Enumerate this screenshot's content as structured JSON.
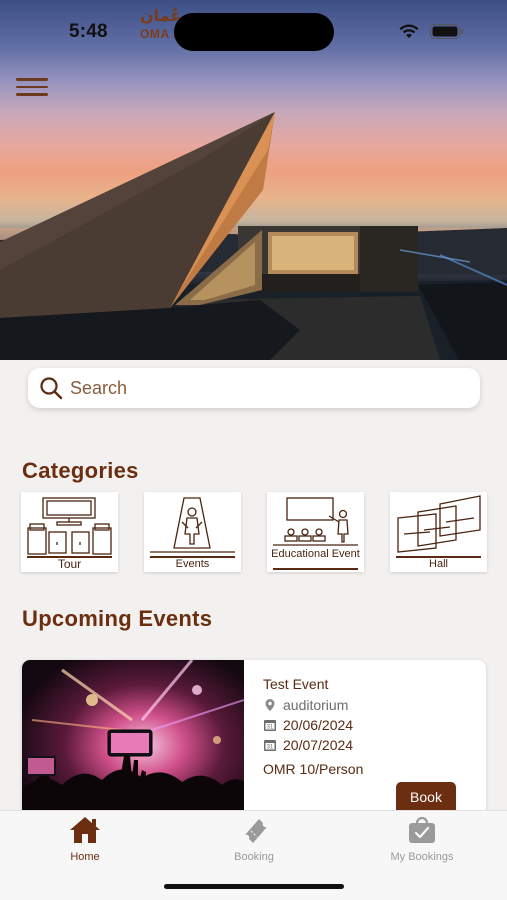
{
  "status_bar": {
    "time": "5:48",
    "museum_name_ar": "متحف عُمان",
    "museum_name_en": "OMA                              EUM..."
  },
  "search": {
    "placeholder": "Search"
  },
  "categories": {
    "title": "Categories",
    "items": [
      {
        "label": "Tour",
        "icon": "tour-icon"
      },
      {
        "label": "Events",
        "icon": "events-icon"
      },
      {
        "label": "Educational Event",
        "icon": "educational-event-icon"
      },
      {
        "label": "Hall",
        "icon": "hall-icon"
      }
    ]
  },
  "upcoming_events": {
    "title": "Upcoming Events",
    "items": [
      {
        "title": "Test Event",
        "location": "auditorium",
        "start_date": "20/06/2024",
        "end_date": "20/07/2024",
        "price": "OMR 10/Person",
        "book_label": "Book"
      }
    ]
  },
  "tab_bar": {
    "tabs": [
      {
        "label": "Home",
        "icon": "home-icon",
        "active": true
      },
      {
        "label": "Booking",
        "icon": "ticket-icon",
        "active": false
      },
      {
        "label": "My Bookings",
        "icon": "bag-check-icon",
        "active": false
      }
    ]
  },
  "colors": {
    "brand": "#6b2e10",
    "inactive": "#9a9a9a",
    "background": "#f3f1ef"
  }
}
